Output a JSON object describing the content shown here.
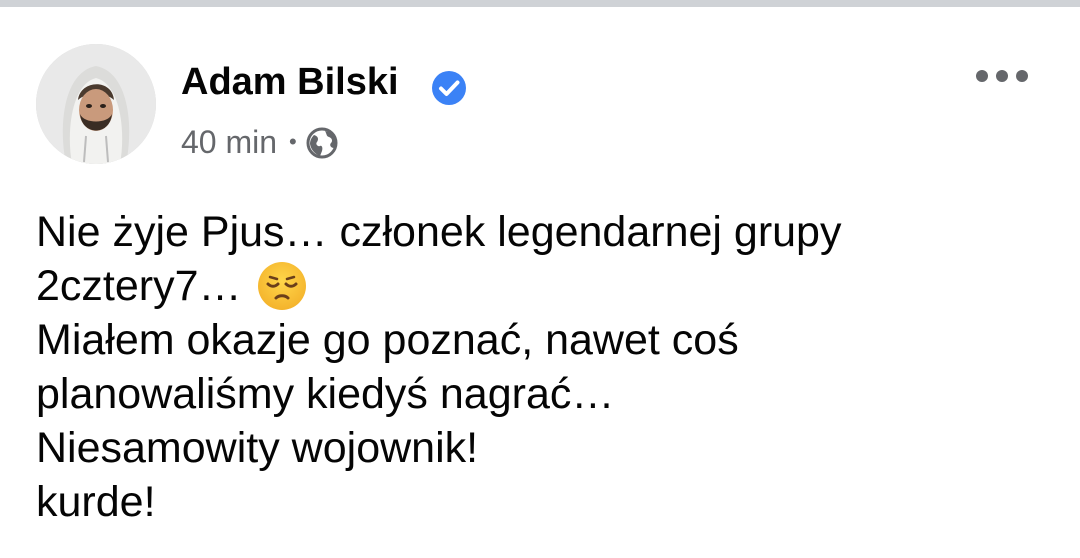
{
  "post": {
    "author": {
      "name": "Adam Bilski",
      "verified_icon": "verified-badge-icon",
      "avatar_icon": "profile-photo"
    },
    "meta": {
      "time": "40 min",
      "separator": "•",
      "audience_icon": "globe-icon"
    },
    "more_icon": "more-options-icon",
    "text": {
      "line1": "Nie żyje Pjus… członek legendarnej grupy",
      "line2": "2cztery7…",
      "line2_emoji": "pensive-face-emoji",
      "line3": "Miałem okazje go poznać, nawet coś",
      "line4": "planowaliśmy kiedyś nagrać…",
      "line5": "Niesamowity wojownik!",
      "line6": "kurde!"
    },
    "colors": {
      "verified_blue": "#3b82f6",
      "secondary_text": "#65676b",
      "primary_text": "#050505",
      "top_border": "#cfd2d6"
    }
  }
}
